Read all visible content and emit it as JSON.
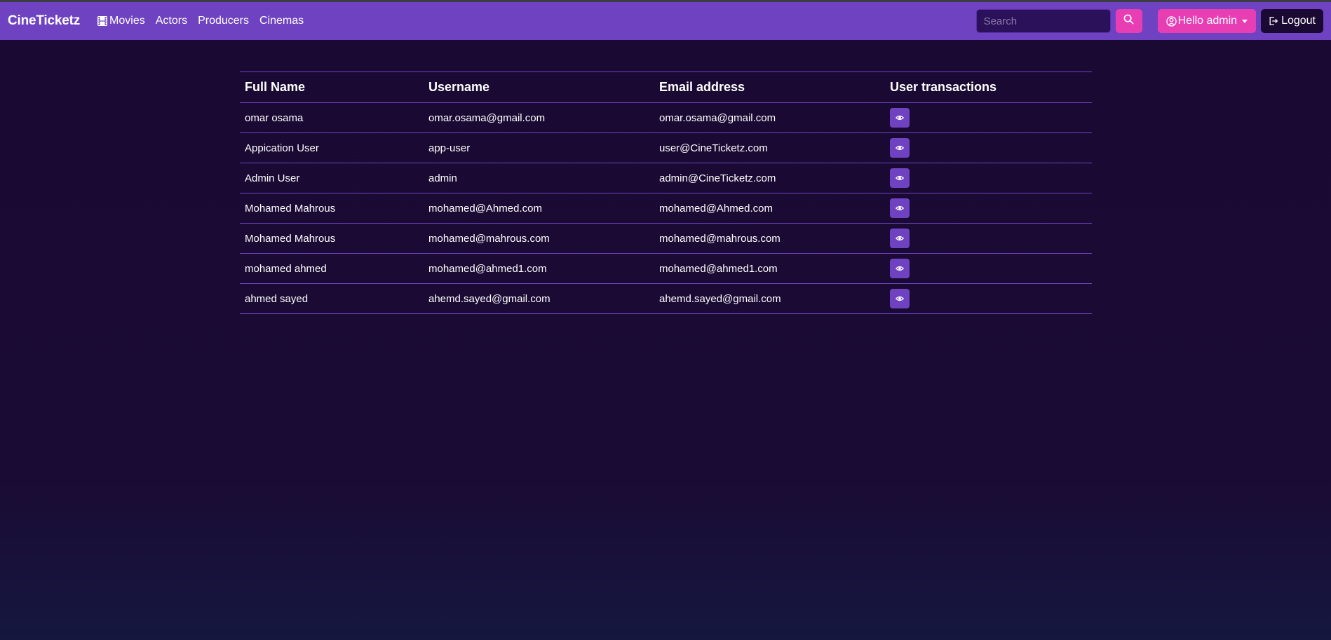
{
  "navbar": {
    "brand": "CineTicketz",
    "links": [
      "Movies",
      "Actors",
      "Producers",
      "Cinemas"
    ],
    "search_placeholder": "Search",
    "user_label": "Hello admin",
    "logout_label": "Logout"
  },
  "table": {
    "headers": [
      "Full Name",
      "Username",
      "Email address",
      "User transactions"
    ],
    "rows": [
      {
        "full_name": "omar osama",
        "username": "omar.osama@gmail.com",
        "email": "omar.osama@gmail.com"
      },
      {
        "full_name": "Appication User",
        "username": "app-user",
        "email": "user@CineTicketz.com"
      },
      {
        "full_name": "Admin User",
        "username": "admin",
        "email": "admin@CineTicketz.com"
      },
      {
        "full_name": "Mohamed Mahrous",
        "username": "mohamed@Ahmed.com",
        "email": "mohamed@Ahmed.com"
      },
      {
        "full_name": "Mohamed Mahrous",
        "username": "mohamed@mahrous.com",
        "email": "mohamed@mahrous.com"
      },
      {
        "full_name": "mohamed ahmed",
        "username": "mohamed@ahmed1.com",
        "email": "mohamed@ahmed1.com"
      },
      {
        "full_name": "ahmed sayed",
        "username": "ahemd.sayed@gmail.com",
        "email": "ahemd.sayed@gmail.com"
      }
    ]
  },
  "colors": {
    "navbar": "#6f42c1",
    "accent": "#e83eb4",
    "background": "#1a0a33"
  },
  "icons": [
    "film-icon",
    "search-icon",
    "user-circle-icon",
    "logout-icon",
    "eye-icon"
  ]
}
